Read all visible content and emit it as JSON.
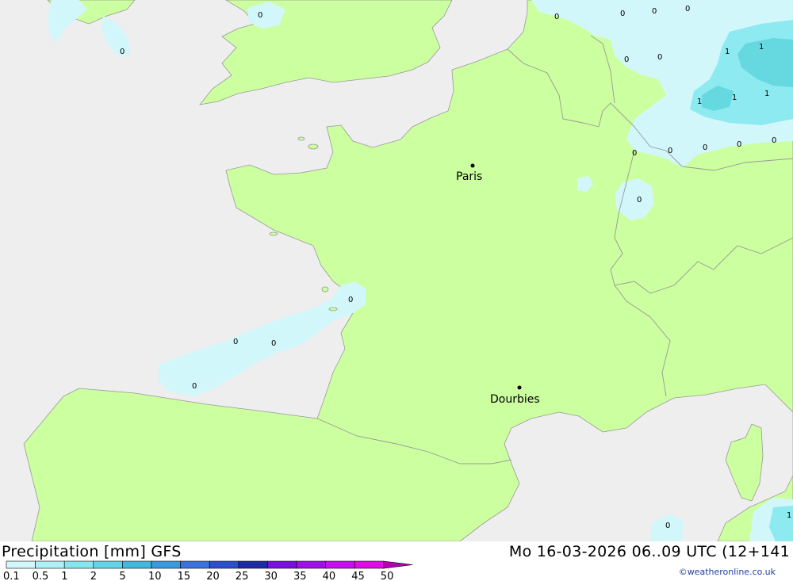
{
  "footer": {
    "title": "Precipitation [mm] GFS",
    "datetime": "Mo 16-03-2026 06..09 UTC (12+141",
    "credit": "©weatheronline.co.uk"
  },
  "legend": {
    "labels": [
      "0.1",
      "0.5",
      "1",
      "2",
      "5",
      "10",
      "15",
      "20",
      "25",
      "30",
      "35",
      "40",
      "45",
      "50"
    ],
    "colors": [
      "#d2f7fa",
      "#aef0f5",
      "#86e6ee",
      "#62d4e6",
      "#40b8e0",
      "#3a9ae0",
      "#3a73e0",
      "#2c4fd0",
      "#1e2ba8",
      "#7a10e0",
      "#a010e8",
      "#c80ef0",
      "#e00ce8",
      "#b400b4"
    ]
  },
  "map": {
    "colors": {
      "sea": "#eeeeee",
      "land": "#ccff9f",
      "precip_light": "#d2f7fa",
      "precip_medium": "#8ceaf0",
      "precip_heavy": "#66d8e0",
      "border": "#999999"
    },
    "cities": [
      {
        "name": "Paris"
      },
      {
        "name": "Dourbies"
      }
    ],
    "value_labels": [
      "0",
      "0",
      "0",
      "0",
      "0",
      "0",
      "0",
      "0",
      "1",
      "1",
      "1",
      "1",
      "1",
      "0",
      "0",
      "0",
      "0",
      "0",
      "0",
      "0",
      "0",
      "0",
      "0",
      "0",
      "1"
    ]
  }
}
